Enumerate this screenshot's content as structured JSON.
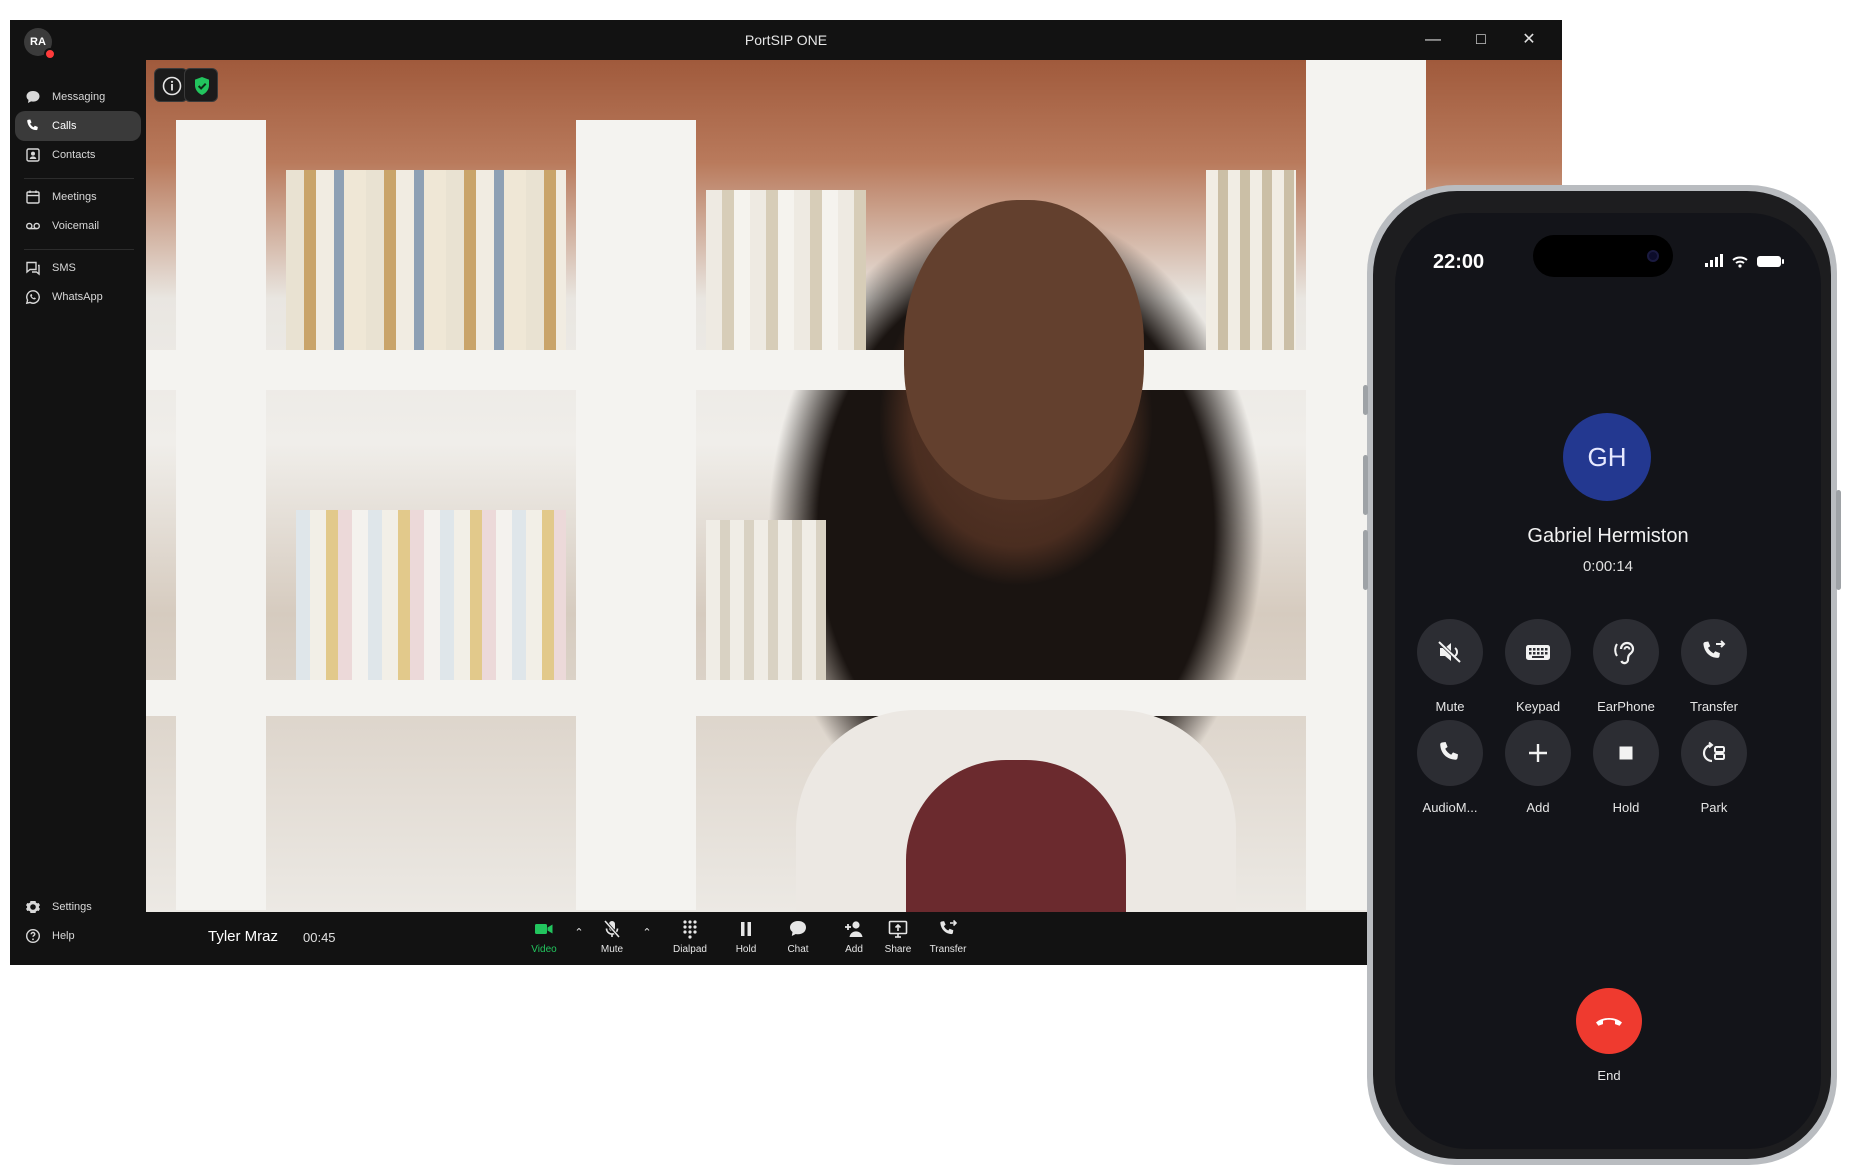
{
  "window": {
    "title": "PortSIP ONE",
    "user_initials": "RA"
  },
  "sidebar": {
    "items": [
      {
        "label": "Messaging",
        "icon": "chat-bubble-icon"
      },
      {
        "label": "Calls",
        "icon": "phone-icon",
        "active": true
      },
      {
        "label": "Contacts",
        "icon": "contact-card-icon"
      },
      {
        "label": "Meetings",
        "icon": "calendar-icon"
      },
      {
        "label": "Voicemail",
        "icon": "voicemail-icon"
      },
      {
        "label": "SMS",
        "icon": "sms-icon"
      },
      {
        "label": "WhatsApp",
        "icon": "whatsapp-icon"
      }
    ],
    "bottom": [
      {
        "label": "Settings",
        "icon": "gear-icon"
      },
      {
        "label": "Help",
        "icon": "help-icon"
      }
    ]
  },
  "call": {
    "caller_name": "Tyler Mraz",
    "duration": "00:45"
  },
  "callbar": {
    "video": "Video",
    "mute": "Mute",
    "dialpad": "Dialpad",
    "hold": "Hold",
    "chat": "Chat",
    "add": "Add",
    "share": "Share",
    "transfer": "Transfer"
  },
  "colors": {
    "accent_green": "#22c55e",
    "end_call_red": "#ef3a2f",
    "avatar_blue": "#233890"
  },
  "phone": {
    "clock": "22:00",
    "contact_initials": "GH",
    "contact_name": "Gabriel Hermiston",
    "call_duration": "0:00:14",
    "buttons": {
      "mute": "Mute",
      "keypad": "Keypad",
      "earphone": "EarPhone",
      "transfer": "Transfer",
      "audio": "AudioM...",
      "add": "Add",
      "hold": "Hold",
      "park": "Park"
    },
    "end_label": "End"
  }
}
